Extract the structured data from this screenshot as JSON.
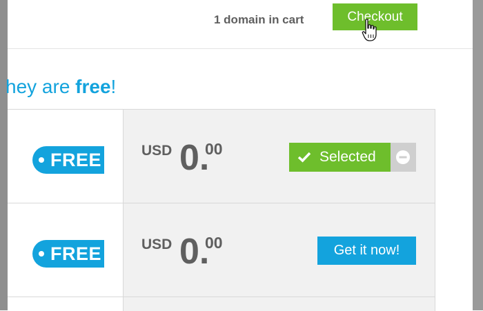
{
  "header": {
    "cart_status": "1 domain in cart",
    "checkout_label": "Checkout"
  },
  "headline": {
    "prefix": "hey are ",
    "emphasis": "free",
    "suffix": "!"
  },
  "results": [
    {
      "badge": "FREE",
      "price": {
        "currency": "USD",
        "whole": "0.",
        "decimals": "00"
      },
      "action": {
        "state": "selected",
        "label": "Selected"
      }
    },
    {
      "badge": "FREE",
      "price": {
        "currency": "USD",
        "whole": "0.",
        "decimals": "00"
      },
      "action": {
        "state": "available",
        "label": "Get it now!"
      }
    }
  ],
  "colors": {
    "brand_blue": "#13a3dd",
    "brand_green": "#6ebe2c",
    "text_gray": "#5f5f5f",
    "row_bg": "#f1f1f1"
  },
  "icons": {
    "cursor": "hand-pointer-icon",
    "selected": "check-icon",
    "remove": "minus-circle-icon",
    "badge_dot": "dot-icon"
  }
}
